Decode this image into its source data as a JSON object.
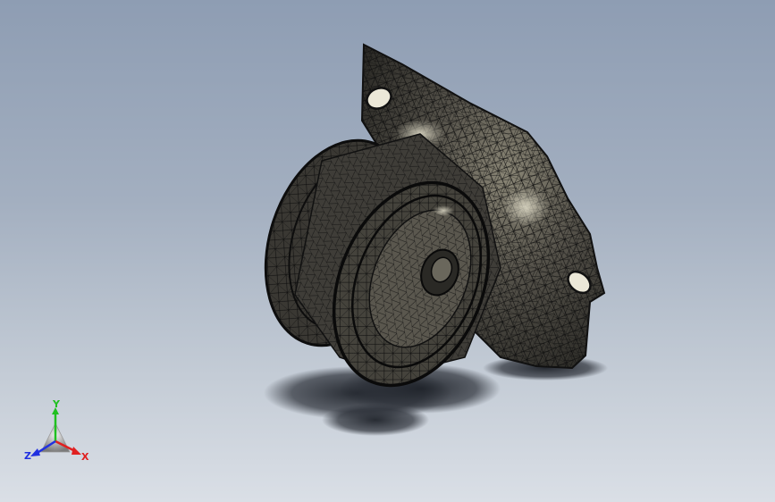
{
  "viewport": {
    "display_mode": "shaded-with-mesh",
    "model": "mesh-part",
    "colors": {
      "background_top": "#8e9db3",
      "background_bottom": "#dadfe6",
      "mesh_edge": "#111111",
      "model_face": "#4a4840",
      "shadow": "#2a2e36"
    }
  },
  "triad": {
    "x_label": "X",
    "y_label": "Y",
    "z_label": "Z",
    "colors": {
      "x": "#e02020",
      "y": "#20c020",
      "z": "#2030e0"
    }
  }
}
